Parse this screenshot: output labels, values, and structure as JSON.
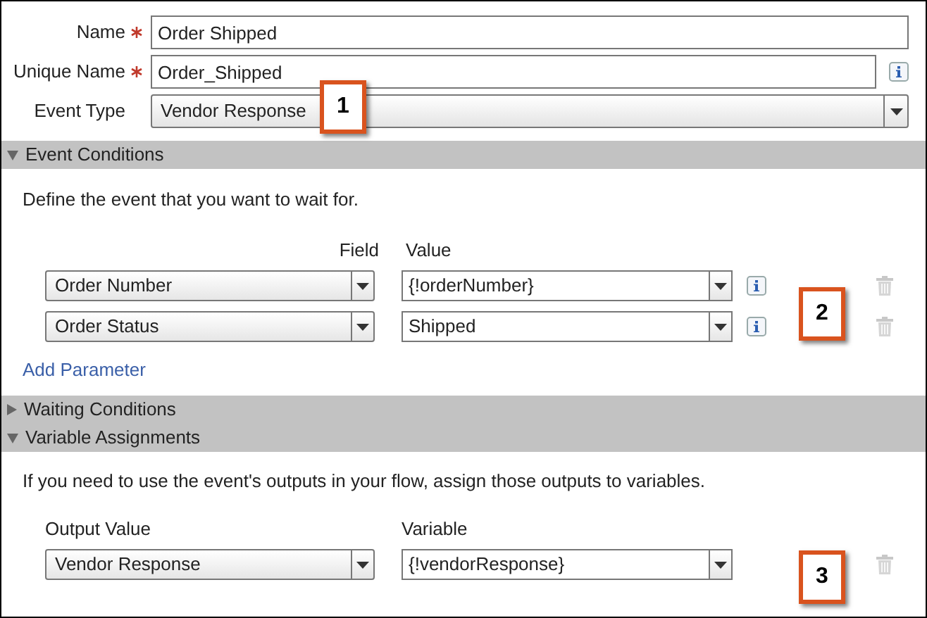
{
  "form": [
    {
      "label": "Name",
      "required": true,
      "kind": "text",
      "value": "Order Shipped",
      "info": false
    },
    {
      "label": "Unique Name",
      "required": true,
      "kind": "text",
      "value": "Order_Shipped",
      "info": true
    },
    {
      "label": "Event Type",
      "required": false,
      "kind": "select",
      "value": "Vendor Response",
      "info": false
    }
  ],
  "event_conditions": {
    "title": "Event Conditions",
    "expanded": true,
    "description": "Define the event that you want to wait for.",
    "column_1": "Field",
    "column_2": "Value",
    "rows": [
      {
        "field": "Order Number",
        "value": "{!orderNumber}"
      },
      {
        "field": "Order Status",
        "value": "Shipped"
      }
    ],
    "add_link": "Add Parameter"
  },
  "waiting_conditions": {
    "title": "Waiting Conditions",
    "expanded": false
  },
  "variable_assignments": {
    "title": "Variable Assignments",
    "expanded": true,
    "description": "If you need to use the event's outputs in your flow, assign those outputs to variables.",
    "column_1": "Output Value",
    "column_2": "Variable",
    "rows": [
      {
        "output": "Vendor Response",
        "variable": "{!vendorResponse}"
      }
    ]
  },
  "callouts": [
    "1",
    "2",
    "3"
  ]
}
